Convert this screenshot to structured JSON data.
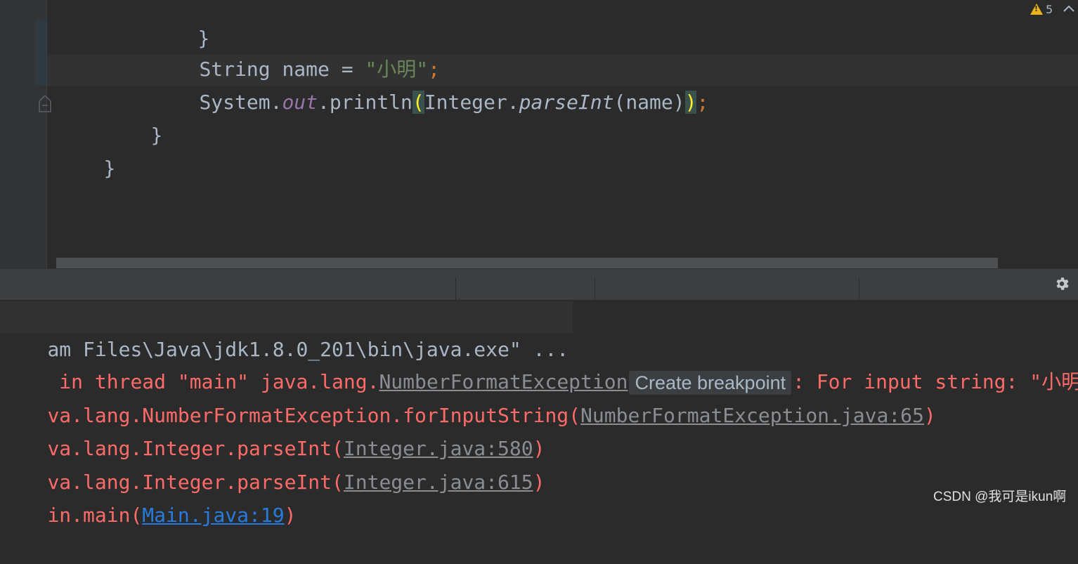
{
  "editor": {
    "lines": {
      "l0_brace": "}",
      "l1_type": "String",
      "l1_var": " name = ",
      "l1_str": "\"小明\"",
      "l1_semi": ";",
      "l2_obj": "System.",
      "l2_field": "out",
      "l2_method": ".println",
      "l2_open": "(",
      "l2_cls": "Integer.",
      "l2_call": "parseInt",
      "l2_arg": "(name)",
      "l2_close": ")",
      "l2_semi": ";",
      "l3_brace": "}",
      "l4_brace": "}"
    },
    "warnings": {
      "count": "5"
    }
  },
  "console": {
    "cmd": "am Files\\Java\\jdk1.8.0_201\\bin\\java.exe\" ...",
    "exc_prefix": " in thread \"main\" java.lang.",
    "exc_class": "NumberFormatException",
    "tooltip": "Create breakpoint",
    "exc_suffix": ": For input string: \"小明\"",
    "trace1_prefix": "va.lang.NumberFormatException.forInputString(",
    "trace1_link": "NumberFormatException.java:65",
    "trace1_suffix": ")",
    "trace2_prefix": "va.lang.Integer.parseInt(",
    "trace2_link": "Integer.java:580",
    "trace2_suffix": ")",
    "trace3_prefix": "va.lang.Integer.parseInt(",
    "trace3_link": "Integer.java:615",
    "trace3_suffix": ")",
    "trace4_prefix": "in.main(",
    "trace4_link": "Main.java:19",
    "trace4_suffix": ")"
  },
  "watermark": "CSDN @我可是ikun啊",
  "colors": {
    "background": "#2b2b2b",
    "error_text": "#ff6b68",
    "link": "#287bde",
    "string": "#6a8759",
    "keyword_punct": "#cc7832",
    "warning": "#e8b41a"
  }
}
